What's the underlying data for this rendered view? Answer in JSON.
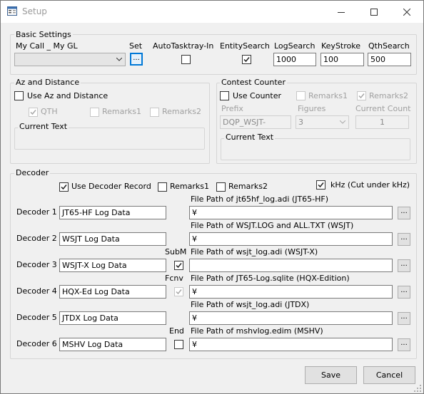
{
  "window": {
    "title": "Setup",
    "minimize": "—",
    "maximize": "☐",
    "close": "✕"
  },
  "basic": {
    "legend": "Basic Settings",
    "mycall_label": "My Call _ My GL",
    "set_label": "Set",
    "set_button": "...",
    "autotasktray_label": "AutoTasktray-In",
    "entitysearch_label": "EntitySearch",
    "logsearch_label": "LogSearch",
    "logsearch_value": "1000",
    "keystroke_label": "KeyStroke",
    "keystroke_value": "100",
    "qthsearch_label": "QthSearch",
    "qthsearch_value": "500"
  },
  "az": {
    "legend": "Az and Distance",
    "use_label": "Use Az and Distance",
    "qth_label": "QTH",
    "remarks1_label": "Remarks1",
    "remarks2_label": "Remarks2",
    "current_text_label": "Current Text"
  },
  "contest": {
    "legend": "Contest Counter",
    "use_label": "Use Counter",
    "remarks1_label": "Remarks1",
    "remarks2_label": "Remarks2",
    "prefix_label": "Prefix",
    "prefix_value": "DQP_WSJT-",
    "figures_label": "Figures",
    "figures_value": "3",
    "current_count_label": "Current Count",
    "current_count_value": "1",
    "current_text_label": "Current Text"
  },
  "decoder": {
    "legend": "Decoder",
    "use_record_label": "Use Decoder Record",
    "remarks1_label": "Remarks1",
    "remarks2_label": "Remarks2",
    "khz_label": "kHz (Cut under kHz)",
    "browse_label": "...",
    "rows": [
      {
        "label": "Decoder 1",
        "name": "JT65-HF Log Data",
        "extra_label": "",
        "path_label": "File Path of jt65hf_log.adi (JT65-HF)",
        "path": "¥"
      },
      {
        "label": "Decoder 2",
        "name": "WSJT Log Data",
        "extra_label": "",
        "path_label": "File Path of WSJT.LOG and ALL.TXT (WSJT)",
        "path": "¥"
      },
      {
        "label": "Decoder 3",
        "name": "WSJT-X Log Data",
        "extra_label": "SubM",
        "path_label": "File Path of wsjt_log.adi (WSJT-X)",
        "path": ""
      },
      {
        "label": "Decoder 4",
        "name": "HQX-Ed Log Data",
        "extra_label": "Fcnv",
        "path_label": "File Path of JT65-Log.sqlite (HQX-Edition)",
        "path": "¥"
      },
      {
        "label": "Decoder 5",
        "name": "JTDX Log Data",
        "extra_label": "",
        "path_label": "File Path of wsjt_log.adi (JTDX)",
        "path": "¥"
      },
      {
        "label": "Decoder 6",
        "name": "MSHV Log Data",
        "extra_label": "End",
        "path_label": "File Path of mshvlog.edim (MSHV)",
        "path": "¥"
      }
    ]
  },
  "buttons": {
    "save": "Save",
    "cancel": "Cancel"
  }
}
